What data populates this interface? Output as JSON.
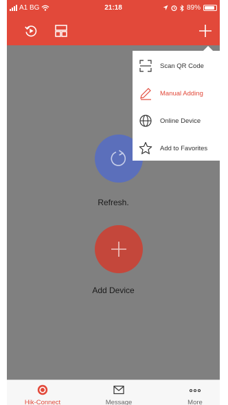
{
  "status_bar": {
    "carrier": "A1 BG",
    "time": "21:18",
    "battery": "89%",
    "battery_level": 0.89,
    "icons": [
      "signal-icon",
      "wifi-icon",
      "location-icon",
      "alarm-icon",
      "bluetooth-icon",
      "battery-icon"
    ]
  },
  "nav_bar": {
    "icons": [
      "playback-icon",
      "layout-icon",
      "add-icon"
    ]
  },
  "menu": {
    "items": [
      {
        "label": "Scan QR Code",
        "icon": "qr-scan-icon",
        "active": false
      },
      {
        "label": "Manual Adding",
        "icon": "pencil-icon",
        "active": true
      },
      {
        "label": "Online Device",
        "icon": "globe-icon",
        "active": false
      },
      {
        "label": "Add to Favorites",
        "icon": "star-icon",
        "active": false
      }
    ]
  },
  "main": {
    "refresh_label": "Refresh.",
    "add_device_label": "Add Device"
  },
  "tab_bar": {
    "tabs": [
      {
        "label": "Hik-Connect",
        "icon": "hik-connect-icon",
        "active": true
      },
      {
        "label": "Message",
        "icon": "message-icon",
        "active": false
      },
      {
        "label": "More",
        "icon": "more-icon",
        "active": false
      }
    ]
  },
  "colors": {
    "brand_red": "#e2493a",
    "refresh_blue": "#5b6fbb",
    "add_red": "#c4473b",
    "overlay_gray": "#808080"
  }
}
